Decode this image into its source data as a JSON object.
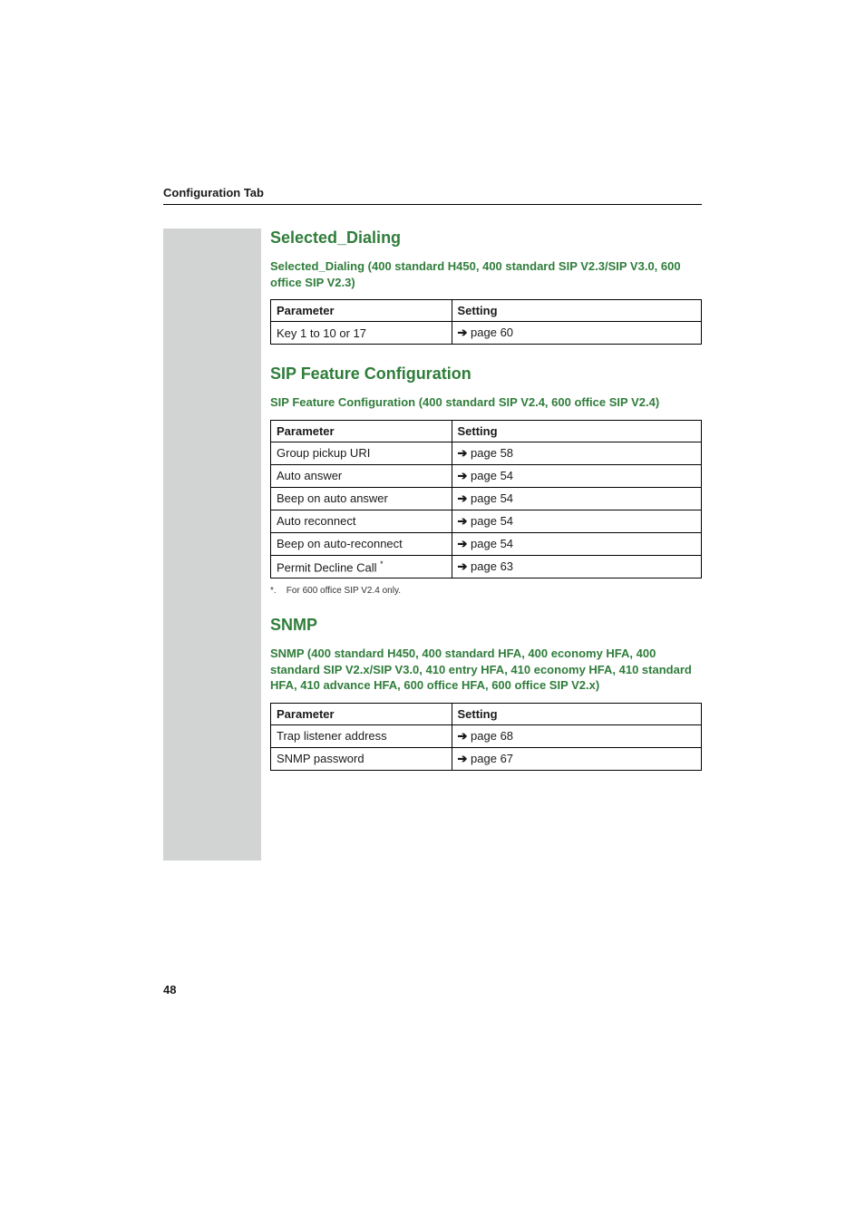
{
  "colors": {
    "accent_green": "#2f7d3a",
    "sidebar_grey": "#d1d4d3"
  },
  "header": {
    "label": "Configuration Tab"
  },
  "page_number": "48",
  "arrow_glyph": "➔",
  "sections": [
    {
      "id": "selected-dialing",
      "title": "Selected_Dialing",
      "subtitle": "Selected_Dialing (400 standard H450, 400 standard SIP V2.3/SIP V3.0, 600 office SIP V2.3)",
      "table": {
        "headers": [
          "Parameter",
          "Setting"
        ],
        "rows": [
          {
            "param": "Key 1 to 10 or 17",
            "setting_page": "page 60"
          }
        ]
      },
      "footnote": null
    },
    {
      "id": "sip-feature-config",
      "title": "SIP Feature Configuration",
      "subtitle": "SIP Feature Configuration (400 standard SIP V2.4, 600 office SIP V2.4)",
      "table": {
        "headers": [
          "Parameter",
          "Setting"
        ],
        "rows": [
          {
            "param": "Group pickup URI",
            "setting_page": "page 58"
          },
          {
            "param": "Auto answer",
            "setting_page": "page 54"
          },
          {
            "param": "Beep on auto answer",
            "setting_page": "page 54"
          },
          {
            "param": "Auto reconnect",
            "setting_page": "page 54"
          },
          {
            "param": "Beep on auto-reconnect",
            "setting_page": "page 54"
          },
          {
            "param": "Permit Decline Call",
            "param_mark": "*",
            "setting_page": "page 63"
          }
        ]
      },
      "footnote": {
        "mark": "*.",
        "text": "For 600 office SIP V2.4 only."
      }
    },
    {
      "id": "snmp",
      "title": "SNMP",
      "subtitle": "SNMP (400 standard H450, 400 standard HFA, 400 economy HFA, 400 standard SIP V2.x/SIP V3.0, 410 entry HFA, 410 economy HFA, 410 standard HFA, 410 advance HFA, 600 office HFA, 600 office SIP V2.x)",
      "table": {
        "headers": [
          "Parameter",
          "Setting"
        ],
        "rows": [
          {
            "param": "Trap listener address",
            "setting_page": "page 68"
          },
          {
            "param": "SNMP password",
            "setting_page": "page 67"
          }
        ]
      },
      "footnote": null
    }
  ]
}
